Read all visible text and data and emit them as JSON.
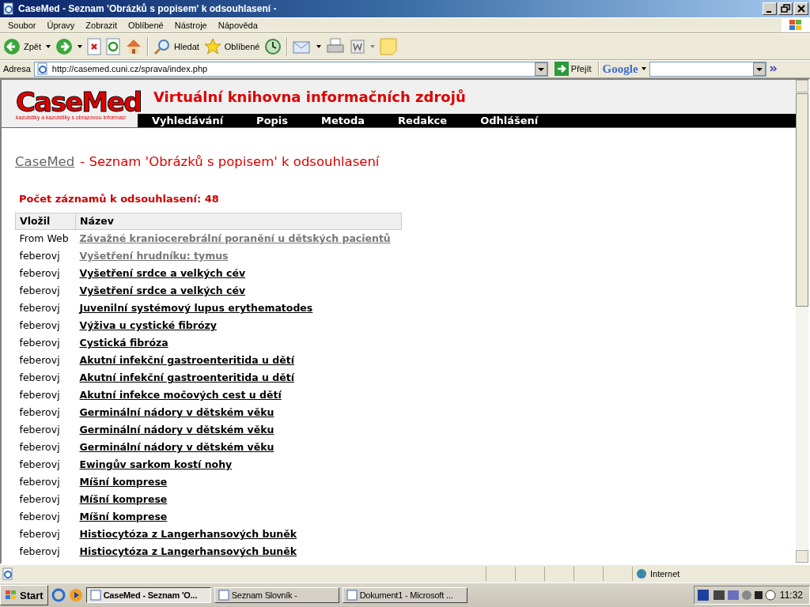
{
  "window": {
    "title": "CaseMed - Seznam 'Obrázků s popisem' k odsouhlasení -"
  },
  "menu": [
    "Soubor",
    "Úpravy",
    "Zobrazit",
    "Oblíbené",
    "Nástroje",
    "Nápověda"
  ],
  "toolbar": {
    "back": "Zpět",
    "search": "Hledat",
    "favorites": "Oblíbené"
  },
  "address": {
    "label": "Adresa",
    "value": "http://casemed.cuni.cz/sprava/index.php",
    "go": "Přejít"
  },
  "google": {
    "label": "Google"
  },
  "site": {
    "logo": "CaseMed",
    "logo_tagline": "kazuistiky a kazuistiky s obrazovou informaci",
    "title": "Virtuální knihovna informačních zdrojů",
    "nav": [
      "Vyhledávání",
      "Popis",
      "Metoda",
      "Redakce",
      "Odhlášení"
    ]
  },
  "page": {
    "home_link": "CaseMed",
    "heading": "- Seznam 'Obrázků s popisem' k odsouhlasení",
    "count": "Počet záznamů k odsouhlasení: 48"
  },
  "table": {
    "columns": [
      "Vložil",
      "Název"
    ],
    "rows": [
      {
        "author": "From Web",
        "title": "Závažné kraniocerebrální poranění u dětských pacientů",
        "visited": true
      },
      {
        "author": "feberovj",
        "title": "Vyšetření hrudníku: tymus",
        "visited": true
      },
      {
        "author": "feberovj",
        "title": "Vyšetření srdce a velkých cév",
        "visited": false
      },
      {
        "author": "feberovj",
        "title": "Vyšetření srdce a velkých cév",
        "visited": false
      },
      {
        "author": "feberovj",
        "title": "Juvenilní systémový lupus erythematodes",
        "visited": false
      },
      {
        "author": "feberovj",
        "title": "Výživa u cystické fibrózy",
        "visited": false
      },
      {
        "author": "feberovj",
        "title": "Cystická fibróza",
        "visited": false
      },
      {
        "author": "feberovj",
        "title": "Akutní infekční gastroenteritida u dětí",
        "visited": false
      },
      {
        "author": "feberovj",
        "title": "Akutní infekční gastroenteritida u dětí",
        "visited": false
      },
      {
        "author": "feberovj",
        "title": "Akutní infekce močových cest u dětí",
        "visited": false
      },
      {
        "author": "feberovj",
        "title": "Germinální nádory v dětském věku",
        "visited": false
      },
      {
        "author": "feberovj",
        "title": "Germinální nádory v dětském věku",
        "visited": false
      },
      {
        "author": "feberovj",
        "title": "Germinální nádory v dětském věku",
        "visited": false
      },
      {
        "author": "feberovj",
        "title": "Ewingův sarkom kostí nohy",
        "visited": false
      },
      {
        "author": "feberovj",
        "title": "Míšní komprese",
        "visited": false
      },
      {
        "author": "feberovj",
        "title": "Míšní komprese",
        "visited": false
      },
      {
        "author": "feberovj",
        "title": "Míšní komprese",
        "visited": false
      },
      {
        "author": "feberovj",
        "title": "Histiocytóza z Langerhansových buněk",
        "visited": false
      },
      {
        "author": "feberovj",
        "title": "Histiocytóza z Langerhansových buněk",
        "visited": false
      }
    ]
  },
  "status_bar": {
    "zone": "Internet"
  },
  "taskbar": {
    "start": "Start",
    "tasks": [
      {
        "label": "CaseMed - Seznam 'O...",
        "selected": true
      },
      {
        "label": "Seznam Slovník -",
        "selected": false
      },
      {
        "label": "Dokument1 - Microsoft ...",
        "selected": false
      }
    ],
    "clock": "11:32"
  }
}
